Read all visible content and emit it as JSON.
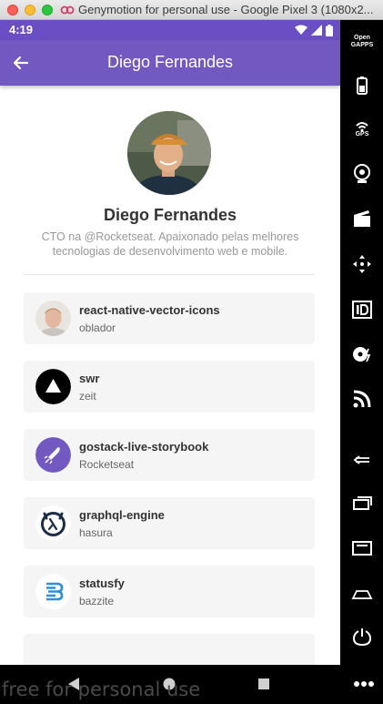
{
  "window": {
    "title": "Genymotion for personal use - Google Pixel 3 (1080x2..."
  },
  "statusbar": {
    "time": "4:19"
  },
  "appbar": {
    "title": "Diego Fernandes"
  },
  "profile": {
    "name": "Diego Fernandes",
    "bio": "CTO na @Rocketseat. Apaixonado pelas melhores tecnologias de desenvolvimento web e mobile."
  },
  "repos": [
    {
      "name": "react-native-vector-icons",
      "owner": "oblador",
      "icon": "person-avatar"
    },
    {
      "name": "swr",
      "owner": "zeit",
      "icon": "zeit-triangle-logo"
    },
    {
      "name": "gostack-live-storybook",
      "owner": "Rocketseat",
      "icon": "rocketseat-logo"
    },
    {
      "name": "graphql-engine",
      "owner": "hasura",
      "icon": "hasura-logo"
    },
    {
      "name": "statusfy",
      "owner": "bazzite",
      "icon": "bazzite-logo"
    }
  ],
  "sidebar": {
    "opengapps_label": "Open GAPPS",
    "gps_label": "GPS"
  },
  "watermark": "free for personal use",
  "colors": {
    "appbar": "#7159c1",
    "statusbar": "#6a4fc4",
    "card": "#f5f5f5"
  }
}
